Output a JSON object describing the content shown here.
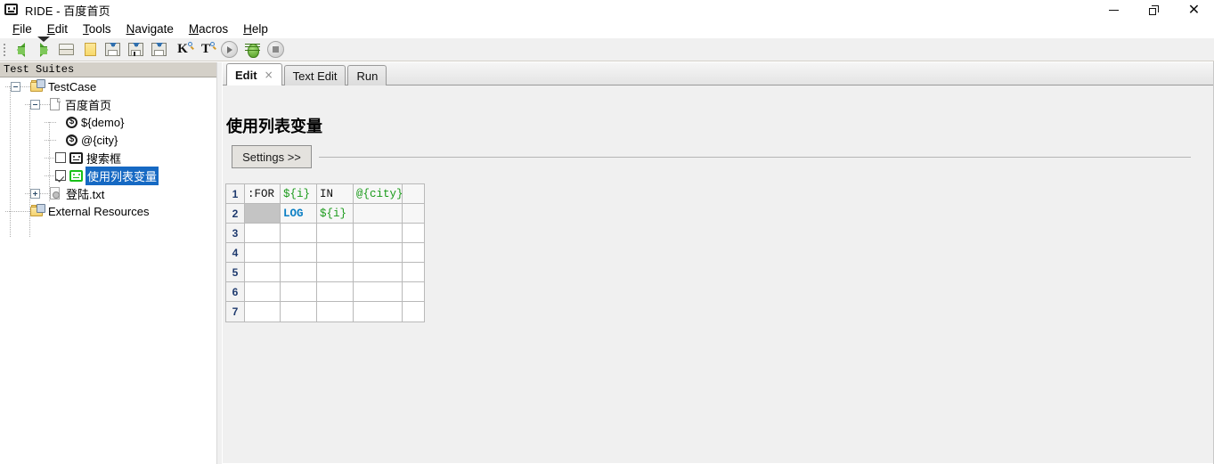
{
  "window": {
    "title": "RIDE - 百度首页",
    "icon": "robot-face-icon",
    "minimize_label": "Minimize",
    "maximize_label": "Restore",
    "close_label": "Close"
  },
  "menubar": {
    "items": [
      {
        "mnemonic": "F",
        "rest": "ile"
      },
      {
        "mnemonic": "E",
        "rest": "dit"
      },
      {
        "mnemonic": "T",
        "rest": "ools"
      },
      {
        "mnemonic": "N",
        "rest": "avigate"
      },
      {
        "mnemonic": "M",
        "rest": "acros"
      },
      {
        "mnemonic": "H",
        "rest": "elp"
      }
    ]
  },
  "toolbar": {
    "buttons": [
      {
        "name": "back-icon",
        "tooltip": "Back"
      },
      {
        "name": "forward-icon",
        "tooltip": "Forward"
      },
      {
        "name": "open-folder-icon",
        "tooltip": "Open Directory"
      },
      {
        "name": "new-folder-icon",
        "tooltip": "New Project"
      },
      {
        "name": "save-icon",
        "tooltip": "Save"
      },
      {
        "name": "save-as-icon",
        "tooltip": "Save As"
      },
      {
        "name": "save-all-icon",
        "tooltip": "Save All"
      },
      {
        "name": "search-keyword-icon",
        "letter": "K",
        "tooltip": "Search Keywords"
      },
      {
        "name": "search-test-icon",
        "letter": "T",
        "tooltip": "Search Tests"
      },
      {
        "name": "run-icon",
        "tooltip": "Run"
      },
      {
        "name": "debug-icon",
        "tooltip": "Debug"
      },
      {
        "name": "stop-icon",
        "tooltip": "Stop"
      }
    ]
  },
  "tree": {
    "header": "Test Suites",
    "nodes": [
      {
        "label": "TestCase",
        "icon": "test-suite-folder-icon",
        "expander": "minus",
        "depth": 0,
        "selected": false
      },
      {
        "label": "百度首页",
        "icon": "test-suite-file-icon",
        "expander": "minus",
        "depth": 1,
        "selected": false
      },
      {
        "label": "${demo}",
        "icon": "scalar-variable-icon",
        "expander": "none",
        "depth": 2,
        "selected": false
      },
      {
        "label": "@{city}",
        "icon": "list-variable-icon",
        "expander": "none",
        "depth": 2,
        "selected": false
      },
      {
        "label": "搜索框",
        "icon": "test-case-icon",
        "expander": "none",
        "depth": 2,
        "selected": false,
        "checked": false
      },
      {
        "label": "使用列表变量",
        "icon": "test-case-icon-green",
        "expander": "none",
        "depth": 2,
        "selected": true,
        "checked": true
      },
      {
        "label": "登陆.txt",
        "icon": "resource-file-icon",
        "expander": "plus",
        "depth": 1,
        "selected": false
      },
      {
        "label": "External Resources",
        "icon": "external-resources-icon",
        "expander": "none",
        "depth": 0,
        "selected": false
      }
    ]
  },
  "editor": {
    "tabs": [
      {
        "label": "Edit",
        "active": true,
        "closable": true,
        "close_glyph": "×"
      },
      {
        "label": "Text Edit",
        "active": false,
        "closable": false
      },
      {
        "label": "Run",
        "active": false,
        "closable": false
      }
    ],
    "doc_title": "使用列表变量",
    "settings_button": "Settings >>",
    "grid": {
      "row_numbers": [
        "1",
        "2",
        "3",
        "4",
        "5",
        "6",
        "7"
      ],
      "rows": [
        [
          {
            "text": ":FOR",
            "style": "black"
          },
          {
            "text": "${i}",
            "style": "green"
          },
          {
            "text": "IN",
            "style": "black"
          },
          {
            "text": "@{city}",
            "style": "green"
          },
          {
            "text": "",
            "style": "black"
          }
        ],
        [
          {
            "text": "",
            "style": "filled"
          },
          {
            "text": "LOG",
            "style": "blue"
          },
          {
            "text": "${i}",
            "style": "green"
          },
          {
            "text": "",
            "style": "black"
          },
          {
            "text": "",
            "style": "black"
          }
        ],
        [
          {
            "text": "",
            "style": "black"
          },
          {
            "text": "",
            "style": "black"
          },
          {
            "text": "",
            "style": "black"
          },
          {
            "text": "",
            "style": "black"
          },
          {
            "text": "",
            "style": "black"
          }
        ],
        [
          {
            "text": "",
            "style": "black"
          },
          {
            "text": "",
            "style": "black"
          },
          {
            "text": "",
            "style": "black"
          },
          {
            "text": "",
            "style": "black"
          },
          {
            "text": "",
            "style": "black"
          }
        ],
        [
          {
            "text": "",
            "style": "black"
          },
          {
            "text": "",
            "style": "black"
          },
          {
            "text": "",
            "style": "black"
          },
          {
            "text": "",
            "style": "black"
          },
          {
            "text": "",
            "style": "black"
          }
        ],
        [
          {
            "text": "",
            "style": "black"
          },
          {
            "text": "",
            "style": "black"
          },
          {
            "text": "",
            "style": "black"
          },
          {
            "text": "",
            "style": "black"
          },
          {
            "text": "",
            "style": "black"
          }
        ],
        [
          {
            "text": "",
            "style": "black"
          },
          {
            "text": "",
            "style": "black"
          },
          {
            "text": "",
            "style": "black"
          },
          {
            "text": "",
            "style": "black"
          },
          {
            "text": "",
            "style": "black"
          }
        ]
      ]
    }
  },
  "colors": {
    "selection_blue": "#1669c3",
    "variable_green": "#1a9a1a",
    "keyword_blue": "#0b7fc4",
    "row_number": "#1e3a6e",
    "filled_cell_gray": "#c4c4c4",
    "panel_gray": "#f0f0f0",
    "tree_header_gray": "#d4d0c8"
  }
}
